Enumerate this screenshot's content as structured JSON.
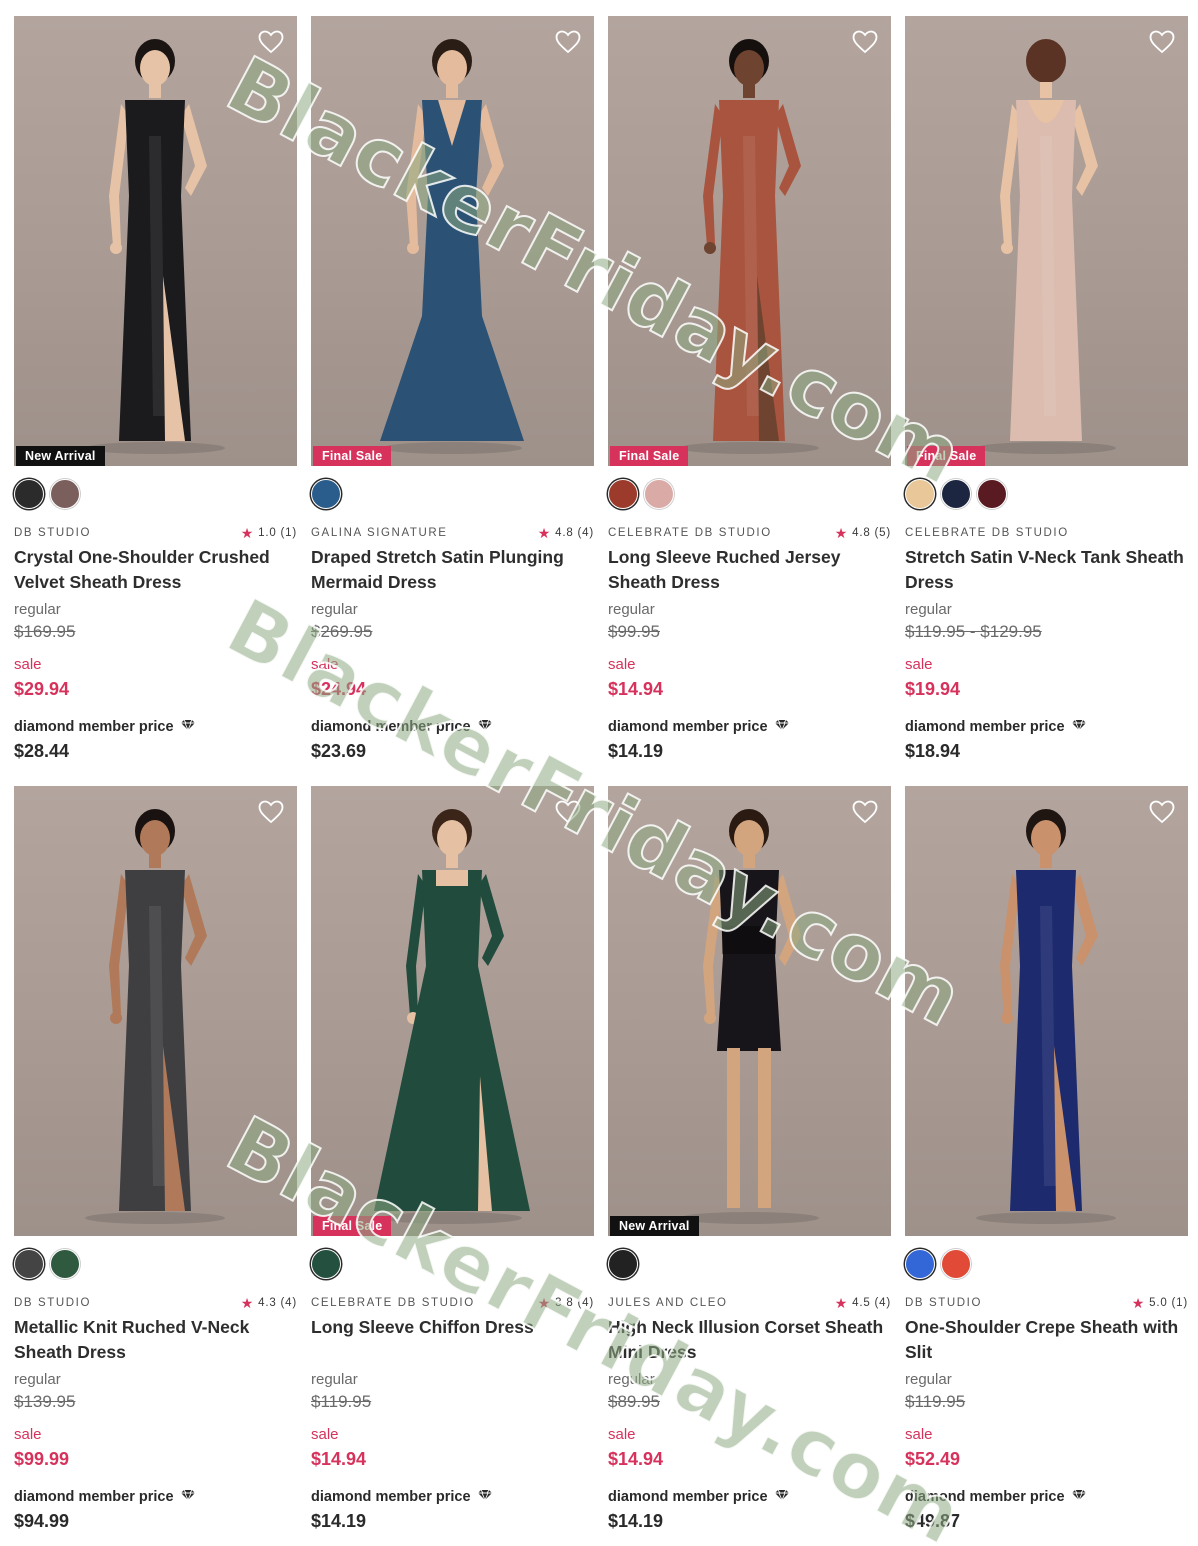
{
  "diamond_label": "diamond member price",
  "labels": {
    "regular": "regular",
    "sale": "sale"
  },
  "watermark": "BlackerFriday.com",
  "colors": {
    "sale": "#d6325c",
    "final_badge": "#d6325c",
    "new_badge": "#111111"
  },
  "products": [
    {
      "brand": "DB STUDIO",
      "rating": "1.0",
      "reviews": "(1)",
      "title": "Crystal One-Shoulder Crushed Velvet Sheath Dress",
      "regular": "$169.95",
      "sale": "$29.94",
      "member": "$28.44",
      "badge": "New Arrival",
      "badge_type": "new",
      "dress_color": "#1b1a1c",
      "skin": "#e6c3a6",
      "hair": "#1a1412",
      "style": "gown-slit",
      "swatches": [
        "#2b2b2b",
        "#7b5f5c"
      ]
    },
    {
      "brand": "GALINA SIGNATURE",
      "rating": "4.8",
      "reviews": "(4)",
      "title": "Draped Stretch Satin Plunging Mermaid Dress",
      "regular": "$269.95",
      "sale": "$24.94",
      "member": "$23.69",
      "badge": "Final Sale",
      "badge_type": "final",
      "dress_color": "#2b5274",
      "skin": "#e4bb9c",
      "hair": "#2a1d16",
      "style": "mermaid",
      "swatches": [
        "#2b5d8c"
      ]
    },
    {
      "brand": "CELEBRATE DB STUDIO",
      "rating": "4.8",
      "reviews": "(5)",
      "title": "Long Sleeve Ruched Jersey Sheath Dress",
      "regular": "$99.95",
      "sale": "$14.94",
      "member": "$14.19",
      "badge": "Final Sale",
      "badge_type": "final",
      "dress_color": "#a9543e",
      "skin": "#6e4330",
      "hair": "#15100e",
      "style": "longsleeve-slit",
      "swatches": [
        "#9c3b2c",
        "#d9aaa6"
      ]
    },
    {
      "brand": "CELEBRATE DB STUDIO",
      "rating": "",
      "reviews": "",
      "title": "Stretch Satin V-Neck Tank Sheath Dress",
      "regular": "$119.95 - $129.95",
      "sale": "$19.94",
      "member": "$18.94",
      "badge": "Final Sale",
      "badge_type": "final",
      "dress_color": "#dcbcaf",
      "skin": "#e7c2a4",
      "hair": "#5a3324",
      "style": "back-gown",
      "swatches": [
        "#e9c798",
        "#1d2640",
        "#5a1a22"
      ]
    },
    {
      "brand": "DB STUDIO",
      "rating": "4.3",
      "reviews": "(4)",
      "title": "Metallic Knit Ruched V-Neck Sheath Dress",
      "regular": "$139.95",
      "sale": "$99.99",
      "member": "$94.99",
      "badge": "",
      "badge_type": "",
      "dress_color": "#3f3f42",
      "skin": "#b07a5a",
      "hair": "#1a1210",
      "style": "gown-slit",
      "swatches": [
        "#444444",
        "#2f5a40"
      ]
    },
    {
      "brand": "CELEBRATE DB STUDIO",
      "rating": "3.8",
      "reviews": "(4)",
      "title": "Long Sleeve Chiffon Dress",
      "regular": "$119.95",
      "sale": "$14.94",
      "member": "$14.19",
      "badge": "Final Sale",
      "badge_type": "final",
      "dress_color": "#214b3c",
      "skin": "#e5c0a2",
      "hair": "#3b2418",
      "style": "longsleeve-aline",
      "swatches": [
        "#24503f"
      ]
    },
    {
      "brand": "JULES AND CLEO",
      "rating": "4.5",
      "reviews": "(4)",
      "title": "High Neck Illusion Corset Sheath Mini Dress",
      "regular": "$89.95",
      "sale": "$14.94",
      "member": "$14.19",
      "badge": "New Arrival",
      "badge_type": "new",
      "dress_color": "#17141a",
      "skin": "#d3a57f",
      "hair": "#2a1a12",
      "style": "mini",
      "swatches": [
        "#222222"
      ]
    },
    {
      "brand": "DB STUDIO",
      "rating": "5.0",
      "reviews": "(1)",
      "title": "One-Shoulder Crepe Sheath with Slit",
      "regular": "$119.95",
      "sale": "$52.49",
      "member": "$49.87",
      "badge": "",
      "badge_type": "",
      "dress_color": "#1d2a6e",
      "skin": "#c9916c",
      "hair": "#1f1511",
      "style": "gown-slit",
      "swatches": [
        "#3366d6",
        "#e04a36"
      ]
    }
  ]
}
